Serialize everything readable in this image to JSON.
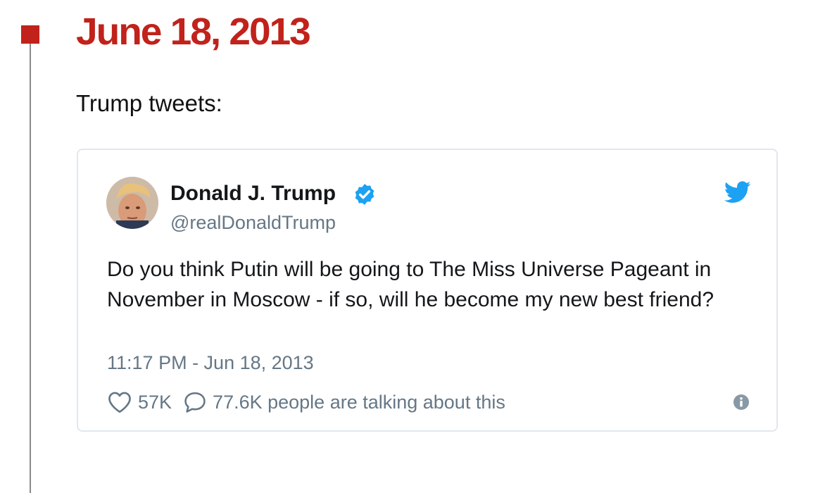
{
  "timeline": {
    "date": "June 18, 2013",
    "intro": "Trump tweets:",
    "accent_color": "#c1221b"
  },
  "tweet": {
    "author_name": "Donald J. Trump",
    "handle": "@realDonaldTrump",
    "verified": true,
    "text": "Do you think Putin will be going to The Miss Universe Pageant in November in Moscow - if so, will he become my new best friend?",
    "timestamp": "11:17 PM - Jun 18, 2013",
    "likes": "57K",
    "talking": "77.6K people are talking about this",
    "icons": [
      "verified-icon",
      "twitter-bird-icon",
      "heart-icon",
      "comment-icon",
      "info-icon"
    ],
    "brand_color": "#1da1f2"
  }
}
